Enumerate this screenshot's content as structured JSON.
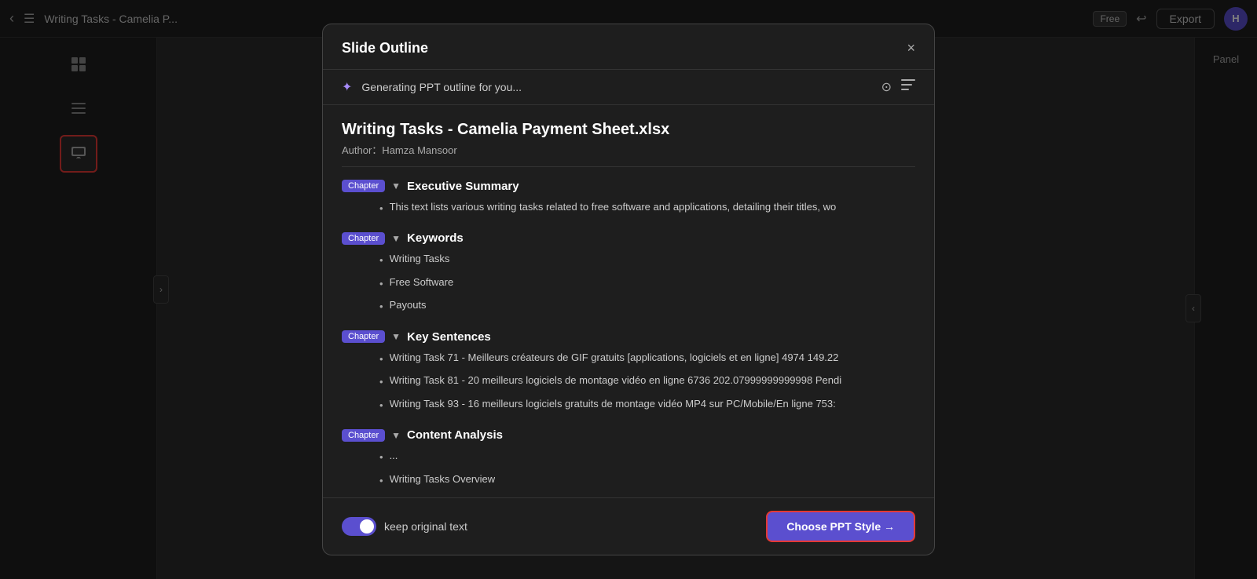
{
  "topbar": {
    "title": "Writing Tasks - Camelia P...",
    "free_label": "Free",
    "export_label": "Export",
    "avatar_initials": "H"
  },
  "panel": {
    "label": "Panel"
  },
  "modal": {
    "title": "Slide Outline",
    "close_icon": "×",
    "generating_text": "Generating PPT outline for you...",
    "doc_title": "Writing Tasks - Camelia Payment Sheet.xlsx",
    "doc_author": "Author：Hamza Mansoor",
    "chapters": [
      {
        "badge": "Chapter",
        "title": "Executive Summary",
        "items": [
          "This text lists various writing tasks related to free software and applications, detailing their titles, wo"
        ]
      },
      {
        "badge": "Chapter",
        "title": "Keywords",
        "items": [
          "Writing Tasks",
          "Free Software",
          "Payouts"
        ]
      },
      {
        "badge": "Chapter",
        "title": "Key Sentences",
        "items": [
          "Writing Task 71 - Meilleurs créateurs de GIF gratuits [applications, logiciels et en ligne] 4974 149.22",
          "Writing Task 81 - 20 meilleurs logiciels de montage vidéo en ligne 6736 202.07999999999998 Pendi",
          "Writing Task 93 - 16 meilleurs logiciels gratuits de montage vidéo MP4 sur PC/Mobile/En ligne 753:"
        ]
      },
      {
        "badge": "Chapter",
        "title": "Content Analysis",
        "items": [
          "...",
          "Writing Tasks Overview"
        ]
      }
    ],
    "footer": {
      "toggle_label": "keep original text",
      "toggle_on": true,
      "choose_ppt_label": "Choose PPT Style →"
    }
  },
  "sidebar": {
    "tools": [
      {
        "name": "grid-view",
        "icon": "⊞",
        "active": false
      },
      {
        "name": "list-view",
        "icon": "☰",
        "active": false
      },
      {
        "name": "presentation-view",
        "icon": "▣",
        "active": true
      }
    ]
  }
}
